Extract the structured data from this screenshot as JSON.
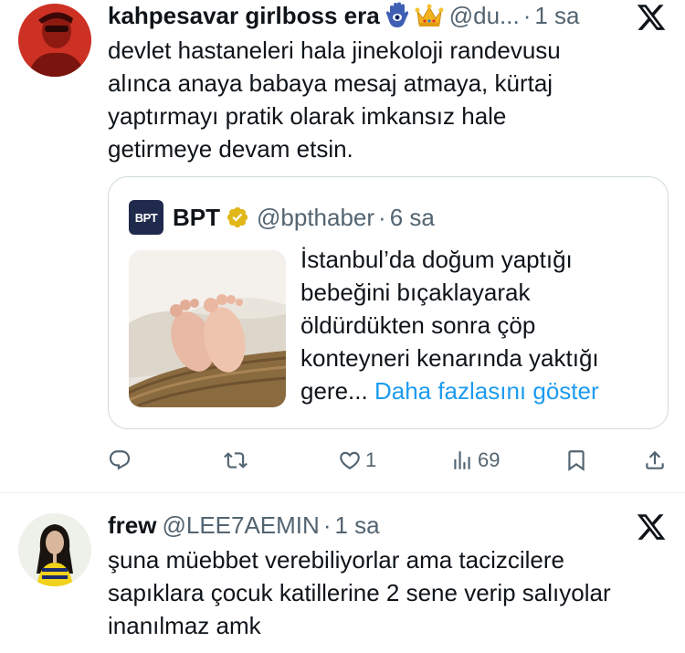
{
  "tweets": [
    {
      "display_name": "kahpesavar girlboss era",
      "name_emojis": [
        "hamsa-emoji",
        "crown-emoji"
      ],
      "handle": "@du...",
      "separator": "·",
      "time": "1 sa",
      "text_lines": [
        "devlet hastaneleri hala jinekoloji randevusu",
        "alınca anaya babaya mesaj atmaya, kürtaj",
        "yaptırmayı pratik olarak imkansız hale",
        "getirmeye devam etsin."
      ],
      "quoted_tweet": {
        "logo_text": "BPT",
        "display_name": "BPT",
        "verified_badge": "gold-check-icon",
        "handle": "@bpthaber",
        "separator": "·",
        "time": "6 sa",
        "text_lines": [
          "İstanbul’da doğum yaptığı",
          "bebeğini bıçaklayarak",
          "öldürdükten sonra çöp",
          "konteyneri kenarında yaktığı"
        ],
        "last_line_prefix": "gere...",
        "show_more_label": "Daha fazlasını göster",
        "image": "baby-feet-in-basket-photo"
      },
      "actions": {
        "reply": {
          "icon": "reply-icon",
          "count": ""
        },
        "retweet": {
          "icon": "retweet-icon",
          "count": ""
        },
        "like": {
          "icon": "heart-icon",
          "count": "1"
        },
        "views": {
          "icon": "views-icon",
          "count": "69"
        },
        "bookmark": {
          "icon": "bookmark-icon",
          "count": ""
        },
        "share": {
          "icon": "share-icon",
          "count": ""
        }
      }
    },
    {
      "display_name": "frew",
      "handle": "@LEE7AEMIN",
      "separator": "·",
      "time": "1 sa",
      "text_lines": [
        "şuna müebbet verebiliyorlar ama tacizcilere",
        "sapıklara çocuk katillerine 2 sene verip salıyolar",
        "inanılmaz amk"
      ]
    }
  ],
  "colors": {
    "text_primary": "#0f1419",
    "text_secondary": "#536471",
    "link": "#1d9bf0",
    "border": "#cfd9de",
    "verified_gold": "#e2b719"
  }
}
